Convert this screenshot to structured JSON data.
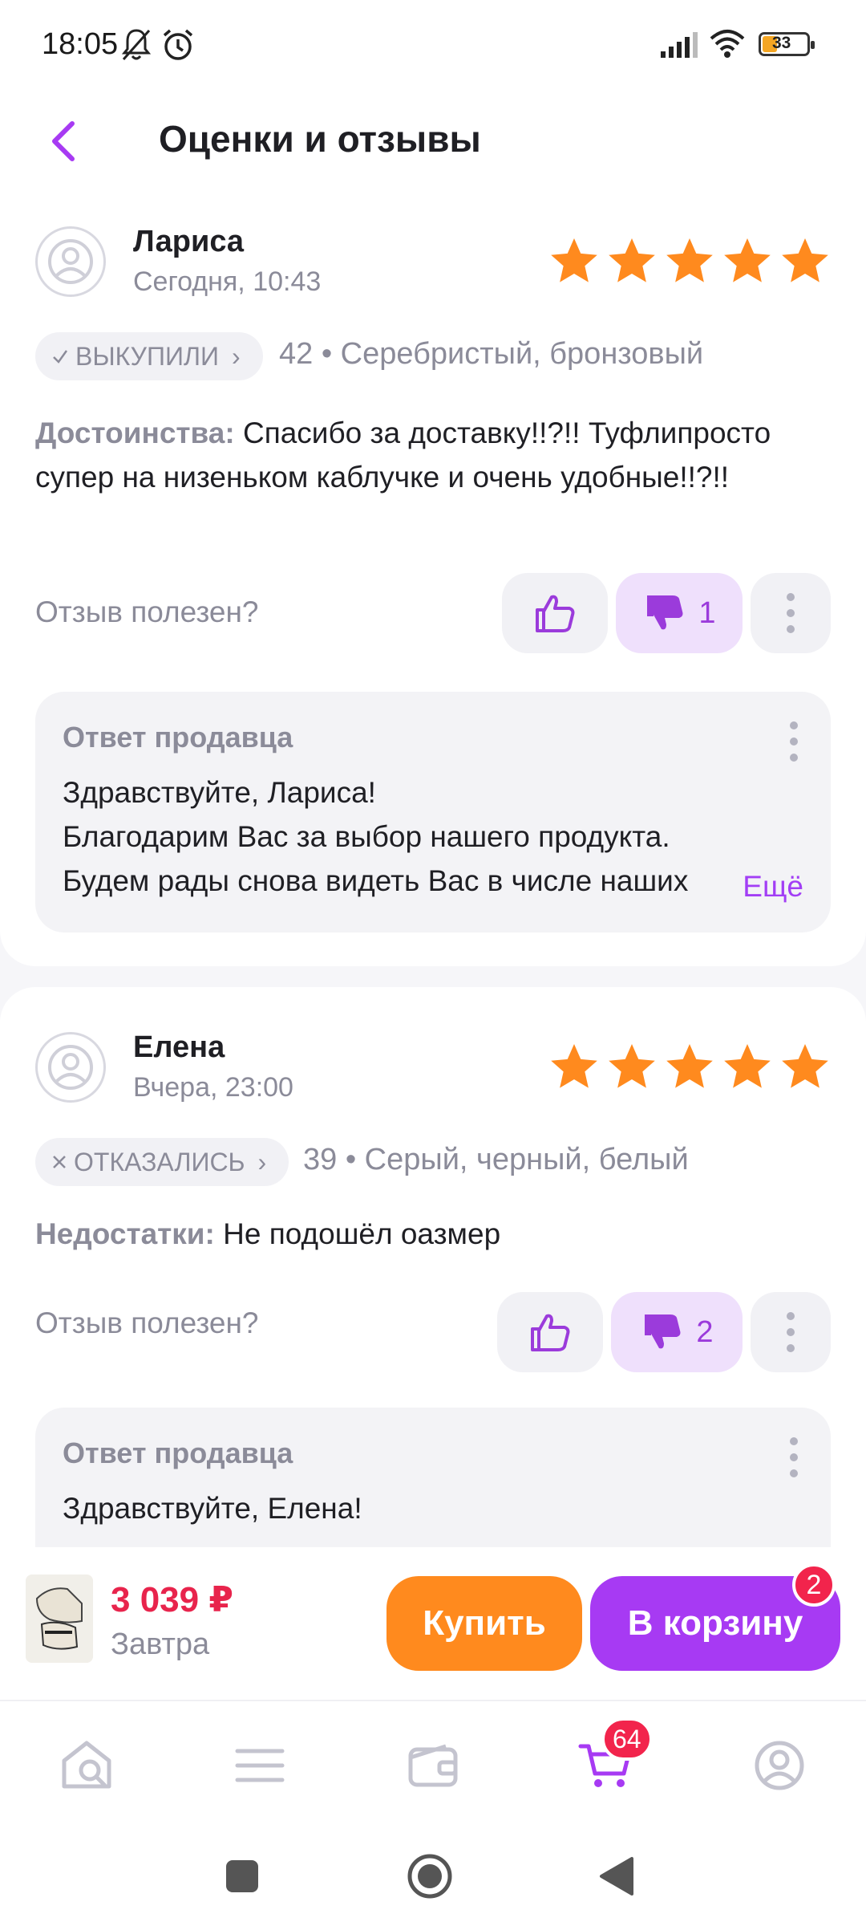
{
  "status_bar": {
    "time": "18:05",
    "battery": "33"
  },
  "header": {
    "title": "Оценки и отзывы"
  },
  "reviews": [
    {
      "author": "Лариса",
      "date": "Сегодня, 10:43",
      "rating": 5,
      "status": "ВЫКУПИЛИ",
      "status_icon": "check-icon",
      "meta": "42 • Серебристый, бронзовый",
      "text_label": "Достоинства:",
      "text": " Спасибо за доставку!!?!! Туфлипросто супер на низеньком каблучке и очень удобные!!?!!",
      "helpful_label": "Отзыв полезен?",
      "likes": "",
      "dislikes": "1",
      "reply": {
        "title": "Ответ продавца",
        "lines": [
          "Здравствуйте, Лариса!",
          "Благодарим Вас за выбор нашего продукта.",
          "Будем рады снова видеть Вас в числе наших"
        ],
        "more": "Ещё"
      }
    },
    {
      "author": "Елена",
      "date": "Вчера, 23:00",
      "rating": 5,
      "status": "ОТКАЗАЛИСЬ",
      "status_icon": "cross-icon",
      "meta": "39 • Серый, черный, белый",
      "text_label": "Недостатки:",
      "text": " Не подошёл оазмер",
      "helpful_label": "Отзыв полезен?",
      "likes": "",
      "dislikes": "2",
      "reply": {
        "title": "Ответ продавца",
        "lines": [
          "Здравствуйте, Елена!"
        ]
      }
    }
  ],
  "buy_bar": {
    "price": "3 039 ₽",
    "delivery": "Завтра",
    "buy_label": "Купить",
    "cart_label": "В корзину",
    "cart_badge": "2"
  },
  "nav": {
    "items": [
      "home-search-icon",
      "catalog-icon",
      "wallet-icon",
      "cart-icon",
      "profile-icon"
    ],
    "cart_badge": "64"
  },
  "colors": {
    "accent": "#a73af3",
    "star": "#ff8a1e",
    "price": "#e8244c",
    "buy": "#ff8a1e"
  }
}
